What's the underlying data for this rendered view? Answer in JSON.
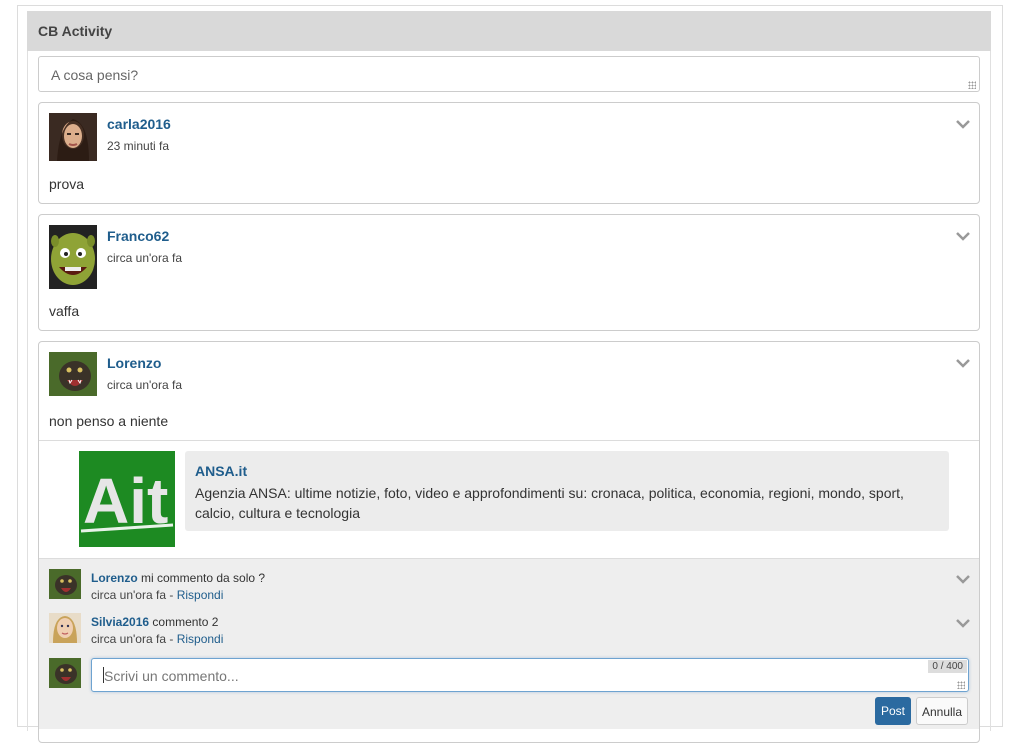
{
  "panel": {
    "title": "CB Activity"
  },
  "status": {
    "placeholder": "A cosa pensi?"
  },
  "posts": [
    {
      "author": "carla2016",
      "time": "23 minuti fa",
      "text": "prova"
    },
    {
      "author": "Franco62",
      "time": "circa un'ora fa",
      "text": "vaffa"
    },
    {
      "author": "Lorenzo",
      "time": "circa un'ora fa",
      "text": "non penso a niente",
      "link": {
        "title": "ANSA.it",
        "description": "Agenzia ANSA: ultime notizie, foto, video e approfondimenti su: cronaca, politica, economia, regioni, mondo, sport, calcio, cultura e tecnologia"
      },
      "comments": [
        {
          "author": "Lorenzo",
          "text": "mi commento da solo ?",
          "time": "circa un'ora fa",
          "separator": "-",
          "reply": "Rispondi"
        },
        {
          "author": "Silvia2016",
          "text": "commento 2",
          "time": "circa un'ora fa",
          "separator": "-",
          "reply": "Rispondi"
        }
      ],
      "comment_input": {
        "placeholder": "Scrivi un commento...",
        "counter": "0 / 400"
      },
      "buttons": {
        "post": "Post",
        "cancel": "Annulla"
      }
    }
  ],
  "logo_text": "Ait"
}
